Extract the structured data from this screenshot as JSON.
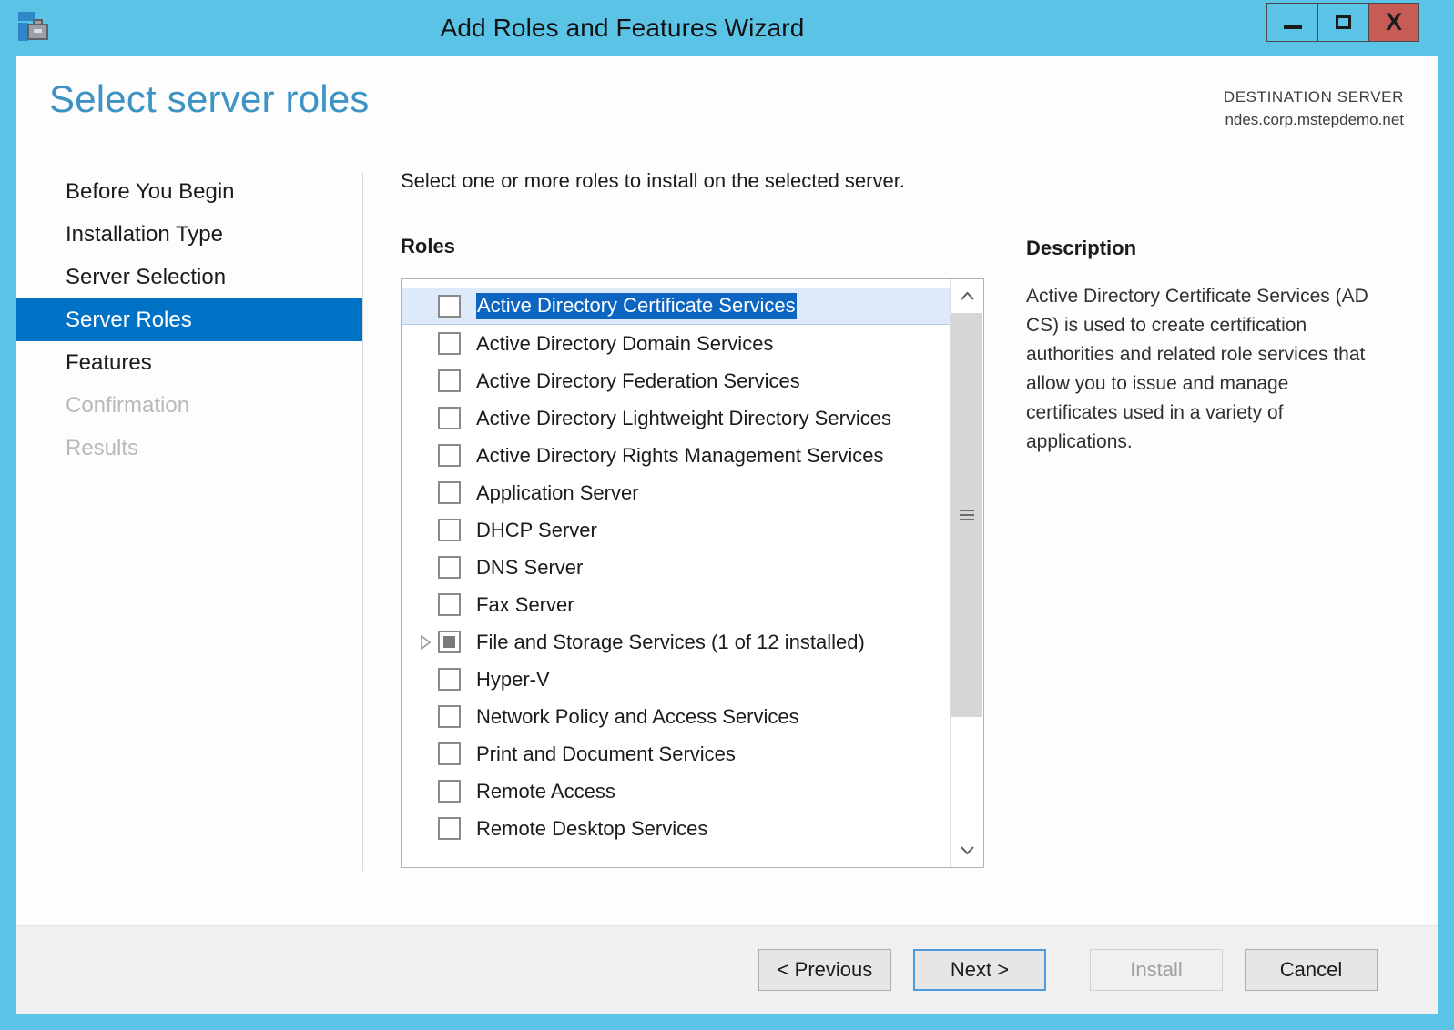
{
  "window": {
    "title": "Add Roles and Features Wizard",
    "icon": "server-features-toolbox-icon",
    "titlebar_color": "#5bc3e6",
    "buttons": {
      "minimize": "minimize-icon",
      "maximize": "maximize-icon",
      "close": "X",
      "close_color": "#c75b55"
    }
  },
  "header": {
    "page_title": "Select server roles",
    "page_title_color": "#3d94c4",
    "destination_label": "DESTINATION SERVER",
    "destination_value": "ndes.corp.mstepdemo.net"
  },
  "sidebar": {
    "items": [
      {
        "label": "Before You Begin",
        "state": "normal"
      },
      {
        "label": "Installation Type",
        "state": "normal"
      },
      {
        "label": "Server Selection",
        "state": "normal"
      },
      {
        "label": "Server Roles",
        "state": "selected"
      },
      {
        "label": "Features",
        "state": "normal"
      },
      {
        "label": "Confirmation",
        "state": "disabled"
      },
      {
        "label": "Results",
        "state": "disabled"
      }
    ],
    "selected_color": "#0072c6"
  },
  "main": {
    "instruction": "Select one or more roles to install on the selected server.",
    "roles_label": "Roles",
    "roles": [
      {
        "label": "Active Directory Certificate Services",
        "checked": "unchecked",
        "selected": true,
        "expandable": false
      },
      {
        "label": "Active Directory Domain Services",
        "checked": "unchecked",
        "selected": false,
        "expandable": false
      },
      {
        "label": "Active Directory Federation Services",
        "checked": "unchecked",
        "selected": false,
        "expandable": false
      },
      {
        "label": "Active Directory Lightweight Directory Services",
        "checked": "unchecked",
        "selected": false,
        "expandable": false
      },
      {
        "label": "Active Directory Rights Management Services",
        "checked": "unchecked",
        "selected": false,
        "expandable": false
      },
      {
        "label": "Application Server",
        "checked": "unchecked",
        "selected": false,
        "expandable": false
      },
      {
        "label": "DHCP Server",
        "checked": "unchecked",
        "selected": false,
        "expandable": false
      },
      {
        "label": "DNS Server",
        "checked": "unchecked",
        "selected": false,
        "expandable": false
      },
      {
        "label": "Fax Server",
        "checked": "unchecked",
        "selected": false,
        "expandable": false
      },
      {
        "label": "File and Storage Services (1 of 12 installed)",
        "checked": "partial",
        "selected": false,
        "expandable": true
      },
      {
        "label": "Hyper-V",
        "checked": "unchecked",
        "selected": false,
        "expandable": false
      },
      {
        "label": "Network Policy and Access Services",
        "checked": "unchecked",
        "selected": false,
        "expandable": false
      },
      {
        "label": "Print and Document Services",
        "checked": "unchecked",
        "selected": false,
        "expandable": false
      },
      {
        "label": "Remote Access",
        "checked": "unchecked",
        "selected": false,
        "expandable": false
      },
      {
        "label": "Remote Desktop Services",
        "checked": "unchecked",
        "selected": false,
        "expandable": false
      }
    ],
    "selection_highlight_color": "#0c65c0",
    "row_highlight_color": "#ddeafa"
  },
  "description": {
    "title": "Description",
    "text": "Active Directory Certificate Services (AD CS) is used to create certification authorities and related role services that allow you to issue and manage certificates used in a variety of applications."
  },
  "footer": {
    "previous_label": "< Previous",
    "next_label": "Next >",
    "install_label": "Install",
    "cancel_label": "Cancel"
  }
}
